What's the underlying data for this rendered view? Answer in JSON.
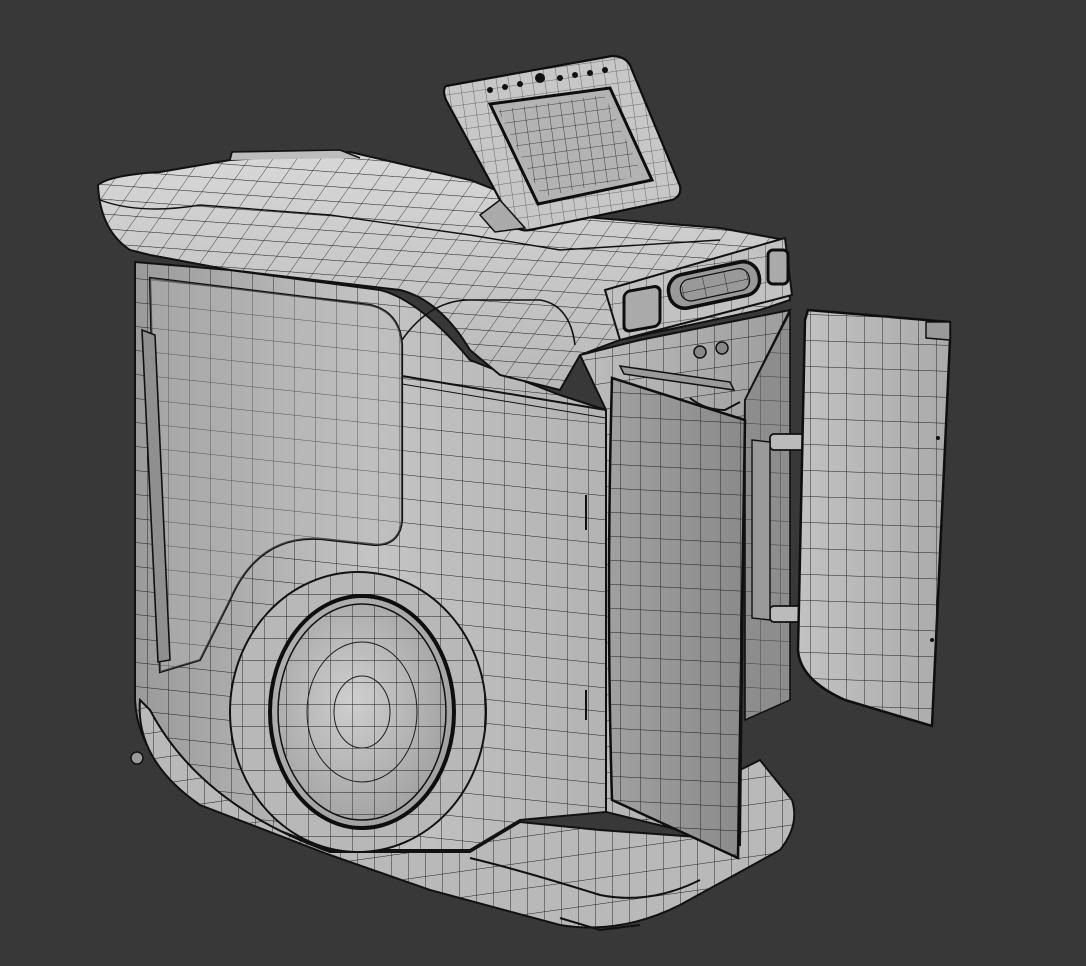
{
  "viewport": {
    "background": "#383838",
    "subject": "kiosk-machine-wireframe",
    "render_mode": "wireframe-on-shaded",
    "colors": {
      "surface_light": "#c9c9c9",
      "surface_mid": "#a9a9a9",
      "surface_dark": "#7d7d7d",
      "wire": "#1e1e1e",
      "edge": "#0f0f0f"
    },
    "icons": [
      "orbit-viewport"
    ]
  }
}
